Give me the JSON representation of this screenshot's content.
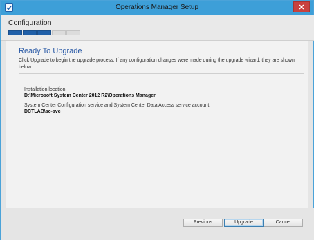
{
  "window": {
    "title": "Operations Manager Setup",
    "accent_color": "#3d9fd8",
    "close_icon": "close-icon"
  },
  "header": {
    "step_title": "Configuration",
    "progress": {
      "completed_steps": 3,
      "total_steps": 5
    }
  },
  "main": {
    "heading": "Ready To Upgrade",
    "description": "Click Upgrade to begin the upgrade process. If any configuration changes were made during the upgrade wizard, they are shown below.",
    "fields": [
      {
        "label": "Installation location:",
        "value": "D:\\Microsoft System Center 2012 R2\\Operations Manager"
      },
      {
        "label": "System Center Configuration service and System Center Data Access service account:",
        "value": "DCTLAB\\sc-svc"
      }
    ]
  },
  "footer": {
    "previous_label": "Previous",
    "upgrade_label": "Upgrade",
    "cancel_label": "Cancel"
  }
}
